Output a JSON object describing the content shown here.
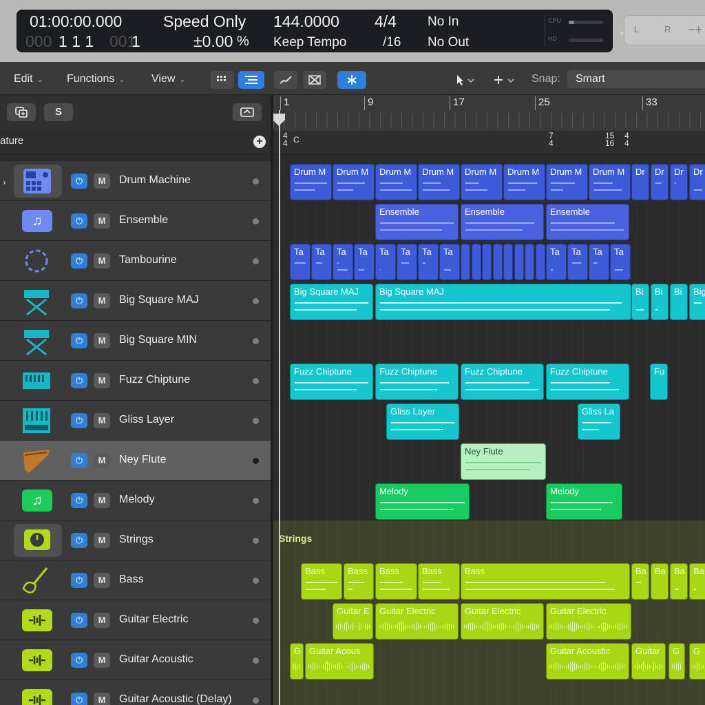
{
  "lcd": {
    "position_time": "01:00:00.000",
    "position_bars_dim": "000",
    "position_bars": "1  1  1",
    "position_ticks_dim": "001",
    "position_ticks": "1",
    "mode": "Speed Only",
    "mode_value": "±0.00",
    "mode_unit": "%",
    "tempo": "144.0000",
    "tempo_mode": "Keep Tempo",
    "signature": "4/4",
    "division": "/16",
    "midi_in": "No In",
    "midi_out": "No Out",
    "cpu_label": "CPU",
    "hd_label": "HD"
  },
  "right_controls": {
    "l": "L",
    "r": "R",
    "minus_plus": "−+"
  },
  "toolbar": {
    "edit": "Edit",
    "functions": "Functions",
    "view": "View",
    "snap_label": "Snap:",
    "snap_value": "Smart"
  },
  "header": {
    "s_button": "S",
    "signature_label": "ature"
  },
  "tracks": [
    {
      "name": "Drum Machine"
    },
    {
      "name": "Ensemble"
    },
    {
      "name": "Tambourine"
    },
    {
      "name": "Big Square MAJ"
    },
    {
      "name": "Big Square MIN"
    },
    {
      "name": "Fuzz Chiptune"
    },
    {
      "name": "Gliss Layer"
    },
    {
      "name": "Ney Flute"
    },
    {
      "name": "Melody"
    },
    {
      "name": "Strings"
    },
    {
      "name": "Bass"
    },
    {
      "name": "Guitar Electric"
    },
    {
      "name": "Guitar Acoustic"
    },
    {
      "name": "Guitar Acoustic (Delay)"
    }
  ],
  "track_buttons": {
    "power": "⏻",
    "mute": "M"
  },
  "ruler": {
    "bars": [
      "1",
      "9",
      "17",
      "25",
      "33"
    ]
  },
  "signatures": {
    "first_num": "4",
    "first_den": "4",
    "key": "C",
    "a_num": "7",
    "a_den": "4",
    "b_num": "15",
    "b_den": "16",
    "c_num": "4",
    "c_den": "4"
  },
  "folder": {
    "strings_label": "Strings"
  },
  "regions": {
    "drum": [
      "Drum M",
      "Drum M",
      "Drum M",
      "Drum M",
      "Drum M",
      "Drum M",
      "Drum M",
      "Drum M",
      "Dr",
      "Dr",
      "Dr",
      "Dr"
    ],
    "ensemble": [
      "Ensemble",
      "Ensemble",
      "Ensemble"
    ],
    "tamb": [
      "Ta",
      "Ta",
      "Ta",
      "Ta",
      "Ta",
      "Ta",
      "Ta",
      "Ta",
      "Ta",
      "Ta",
      "Ta",
      "Ta"
    ],
    "bigmaj": [
      "Big Square MAJ",
      "Big Square MAJ",
      "Bi",
      "Bi",
      "Bi",
      "Big"
    ],
    "fuzz": [
      "Fuzz Chiptune",
      "Fuzz Chiptune",
      "Fuzz Chiptune",
      "Fuzz Chiptune",
      "Fu"
    ],
    "gliss": [
      "Gliss Layer",
      "Gliss La"
    ],
    "ney": [
      "Ney Flute"
    ],
    "melody": [
      "Melody",
      "Melody"
    ],
    "bass": [
      "Bass",
      "Bass",
      "Bass",
      "Bass",
      "Bass",
      "Ba",
      "Ba",
      "Ba",
      "Ba"
    ],
    "gelec": [
      "Guitar E",
      "Guitar Electric",
      "Guitar Electric",
      "Guitar Electric"
    ],
    "gacou": [
      "G",
      "Guitar Acous",
      "Guitar Acoustic",
      "Guitar",
      "G",
      "G"
    ]
  }
}
